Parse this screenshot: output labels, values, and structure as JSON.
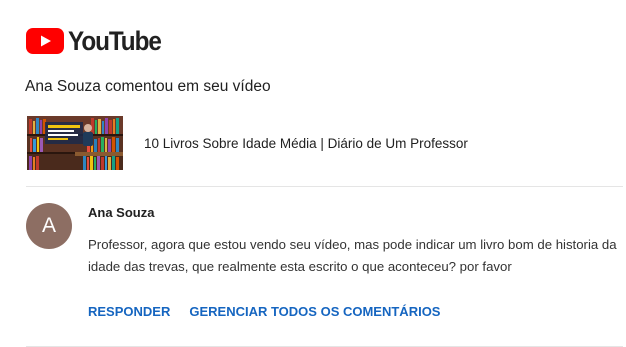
{
  "brand": {
    "name": "YouTube",
    "logo_icon": "youtube-play-icon",
    "accent": "#ff0000"
  },
  "notification": {
    "headline": "Ana Souza comentou em seu vídeo",
    "video_title": "10 Livros Sobre Idade Média | Diário de Um Professor"
  },
  "comment": {
    "avatar_letter": "A",
    "avatar_color": "#8d6e63",
    "author": "Ana Souza",
    "text": "Professor, agora que estou vendo seu vídeo, mas pode indicar um livro bom de historia da idade das trevas, que realmente esta escrito o que aconteceu? por favor"
  },
  "actions": {
    "reply_label": "RESPONDER",
    "manage_label": "GERENCIAR TODOS OS COMENTÁRIOS",
    "color": "#1565c0"
  }
}
